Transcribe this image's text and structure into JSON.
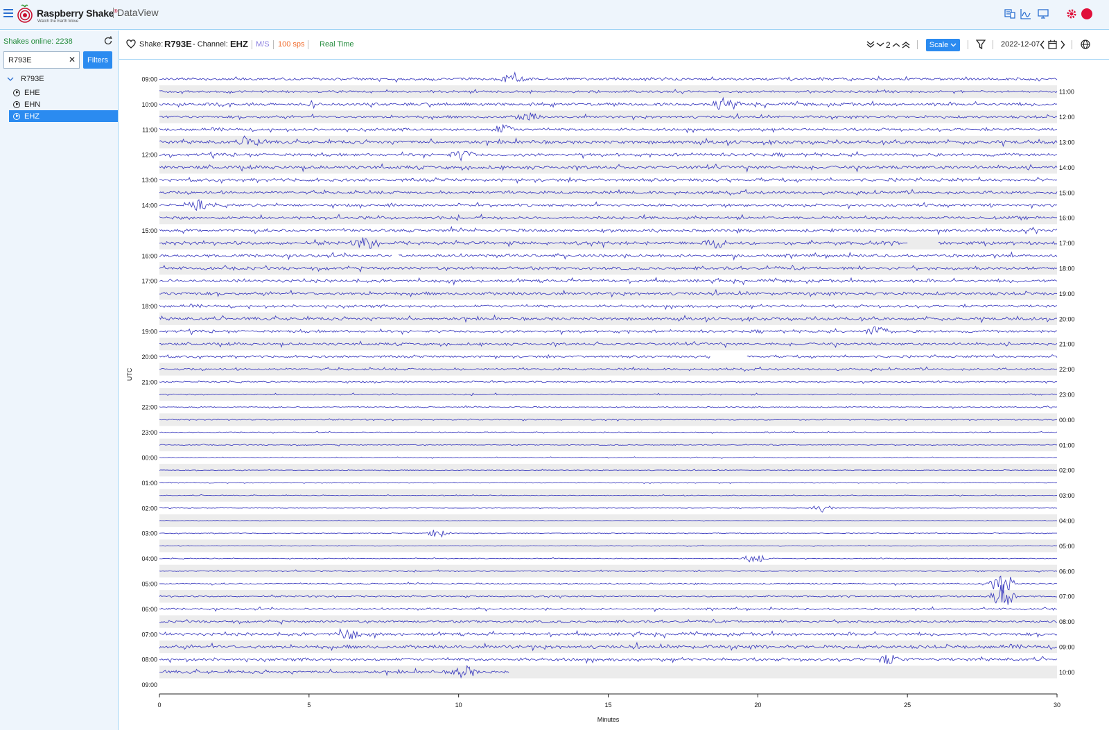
{
  "header": {
    "brand_main": "Raspberry Shake",
    "brand_reg": "®",
    "tagline": "Watch the Earth Move",
    "app_name": "DataView",
    "icons": [
      "map-list-icon",
      "chart-icon",
      "live-monitor-icon",
      "settings-icon",
      "user-icon"
    ]
  },
  "sidebar": {
    "online_label": "Shakes online: 2238",
    "search_value": "R793E",
    "search_clear": "✕",
    "filters_label": "Filters",
    "station": "R793E",
    "channels": [
      {
        "label": "EHE",
        "active": false
      },
      {
        "label": "EHN",
        "active": false
      },
      {
        "label": "EHZ",
        "active": true
      }
    ]
  },
  "toolbar": {
    "shake_prefix": "Shake:",
    "station_id": "R793E",
    "channel_prefix": "- Channel:",
    "channel_id": "EHZ",
    "units": "M/S",
    "rate": "100 sps",
    "mode": "Real Time",
    "zoom_value": "2",
    "scale_label": "Scale",
    "date": "2022-12-07",
    "colors": {
      "units": "#8a7fe0",
      "rate": "#f06a2a",
      "mode": "#218a3a"
    }
  },
  "chart_data": {
    "type": "helicorder",
    "y_axis_label": "UTC",
    "x_axis_label": "Minutes",
    "x_ticks": [
      0,
      5,
      10,
      15,
      20,
      25,
      30
    ],
    "xlim": [
      0,
      30
    ],
    "left_labels": [
      "09:00",
      "10:00",
      "11:00",
      "12:00",
      "13:00",
      "14:00",
      "15:00",
      "16:00",
      "17:00",
      "18:00",
      "19:00",
      "20:00",
      "21:00",
      "22:00",
      "23:00",
      "00:00",
      "01:00",
      "02:00",
      "03:00",
      "04:00",
      "05:00",
      "06:00",
      "07:00",
      "08:00",
      "09:00"
    ],
    "right_labels": [
      "11:00",
      "12:00",
      "13:00",
      "14:00",
      "15:00",
      "16:00",
      "17:00",
      "18:00",
      "19:00",
      "20:00",
      "21:00",
      "22:00",
      "23:00",
      "00:00",
      "01:00",
      "02:00",
      "03:00",
      "04:00",
      "05:00",
      "06:00",
      "07:00",
      "08:00",
      "09:00",
      "10:00"
    ],
    "trace_count": 48,
    "last_trace_end_minutes": 11.7,
    "trace_color": "#4040c0",
    "alt_row_color": "#ececec",
    "noise_amplitude": [
      0.7,
      0.6,
      0.8,
      0.7,
      0.7,
      0.9,
      0.8,
      0.9,
      0.8,
      0.8,
      0.7,
      0.8,
      0.8,
      0.9,
      0.8,
      0.8,
      0.8,
      0.8,
      0.7,
      0.8,
      0.7,
      0.7,
      0.6,
      0.6,
      0.35,
      0.35,
      0.3,
      0.3,
      0.25,
      0.25,
      0.2,
      0.2,
      0.2,
      0.2,
      0.15,
      0.15,
      0.2,
      0.2,
      0.2,
      0.3,
      0.35,
      0.4,
      0.5,
      0.6,
      0.8,
      0.9,
      0.8,
      0.8
    ],
    "events": [
      {
        "trace": 0,
        "minute": 11.8,
        "amp": 3
      },
      {
        "trace": 2,
        "minute": 18.9,
        "amp": 4
      },
      {
        "trace": 3,
        "minute": 12.3,
        "amp": 3
      },
      {
        "trace": 4,
        "minute": 11.5,
        "amp": 3
      },
      {
        "trace": 5,
        "minute": 3.1,
        "amp": 4
      },
      {
        "trace": 6,
        "minute": 10.1,
        "amp": 3
      },
      {
        "trace": 10,
        "minute": 1.3,
        "amp": 3
      },
      {
        "trace": 13,
        "minute": 6.9,
        "amp": 4
      },
      {
        "trace": 13,
        "minute": 18.6,
        "amp": 3
      },
      {
        "trace": 20,
        "minute": 24.0,
        "amp": 4
      },
      {
        "trace": 38,
        "minute": 19.9,
        "amp": 4
      },
      {
        "trace": 34,
        "minute": 22.2,
        "amp": 3
      },
      {
        "trace": 36,
        "minute": 9.3,
        "amp": 3
      },
      {
        "trace": 40,
        "minute": 28.2,
        "amp": 8
      },
      {
        "trace": 41,
        "minute": 28.2,
        "amp": 9
      },
      {
        "trace": 44,
        "minute": 6.3,
        "amp": 4
      },
      {
        "trace": 46,
        "minute": 24.4,
        "amp": 3
      },
      {
        "trace": 47,
        "minute": 10.2,
        "amp": 4
      }
    ],
    "gaps": [
      {
        "trace": 13,
        "start": 25.0,
        "end": 26.0
      },
      {
        "trace": 14,
        "start": 7.8,
        "end": 8.0
      },
      {
        "trace": 22,
        "start": 18.4,
        "end": 19.6
      }
    ]
  }
}
